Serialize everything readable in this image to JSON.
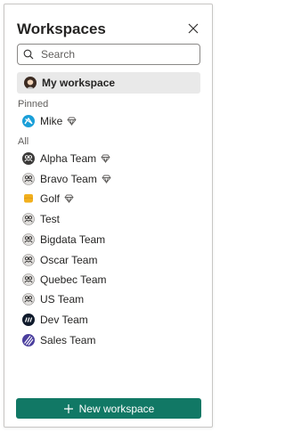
{
  "header": {
    "title": "Workspaces"
  },
  "search": {
    "placeholder": "Search",
    "value": ""
  },
  "my_workspace": {
    "label": "My workspace"
  },
  "pinned": {
    "label": "Pinned",
    "items": [
      {
        "label": "Mike",
        "icon": "mike-avatar-icon",
        "premium": true
      }
    ]
  },
  "all": {
    "label": "All",
    "items": [
      {
        "label": "Alpha Team",
        "icon": "team-icon",
        "premium": true
      },
      {
        "label": "Bravo Team",
        "icon": "team-icon",
        "premium": true
      },
      {
        "label": "Golf",
        "icon": "golf-icon",
        "premium": true
      },
      {
        "label": "Test",
        "icon": "team-icon",
        "premium": false
      },
      {
        "label": "Bigdata Team",
        "icon": "team-icon",
        "premium": false
      },
      {
        "label": "Oscar Team",
        "icon": "team-icon",
        "premium": false
      },
      {
        "label": "Quebec Team",
        "icon": "team-icon",
        "premium": false
      },
      {
        "label": "US Team",
        "icon": "team-icon",
        "premium": false
      },
      {
        "label": "Dev Team",
        "icon": "dev-team-logo-icon",
        "premium": false
      },
      {
        "label": "Sales Team",
        "icon": "sales-team-logo-icon",
        "premium": false
      }
    ]
  },
  "footer": {
    "new_workspace_label": "New workspace"
  },
  "colors": {
    "accent": "#117865",
    "selected_bg": "#e9e9e9"
  }
}
